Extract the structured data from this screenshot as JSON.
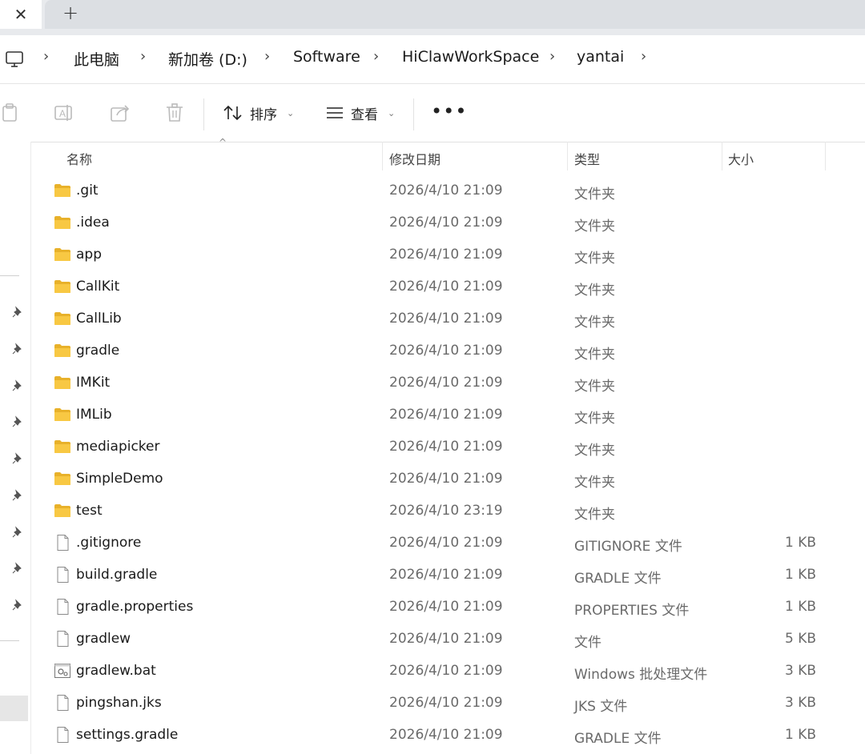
{
  "tabs": {
    "close_glyph": "✕",
    "new_glyph": "+"
  },
  "breadcrumb": [
    {
      "label": "此电脑"
    },
    {
      "label": "新加卷 (D:)"
    },
    {
      "label": "Software"
    },
    {
      "label": "HiClawWorkSpace"
    },
    {
      "label": "yantai"
    }
  ],
  "toolbar": {
    "sort_label": "排序",
    "view_label": "查看",
    "more_glyph": "•••"
  },
  "columns": {
    "name": "名称",
    "date": "修改日期",
    "type": "类型",
    "size": "大小"
  },
  "files": [
    {
      "name": ".git",
      "date": "2026/4/10 21:09",
      "type": "文件夹",
      "size": "",
      "icon": "folder-icon"
    },
    {
      "name": ".idea",
      "date": "2026/4/10 21:09",
      "type": "文件夹",
      "size": "",
      "icon": "folder-icon"
    },
    {
      "name": "app",
      "date": "2026/4/10 21:09",
      "type": "文件夹",
      "size": "",
      "icon": "folder-icon"
    },
    {
      "name": "CallKit",
      "date": "2026/4/10 21:09",
      "type": "文件夹",
      "size": "",
      "icon": "folder-icon"
    },
    {
      "name": "CallLib",
      "date": "2026/4/10 21:09",
      "type": "文件夹",
      "size": "",
      "icon": "folder-icon"
    },
    {
      "name": "gradle",
      "date": "2026/4/10 21:09",
      "type": "文件夹",
      "size": "",
      "icon": "folder-icon"
    },
    {
      "name": "IMKit",
      "date": "2026/4/10 21:09",
      "type": "文件夹",
      "size": "",
      "icon": "folder-icon"
    },
    {
      "name": "IMLib",
      "date": "2026/4/10 21:09",
      "type": "文件夹",
      "size": "",
      "icon": "folder-icon"
    },
    {
      "name": "mediapicker",
      "date": "2026/4/10 21:09",
      "type": "文件夹",
      "size": "",
      "icon": "folder-icon"
    },
    {
      "name": "SimpleDemo",
      "date": "2026/4/10 21:09",
      "type": "文件夹",
      "size": "",
      "icon": "folder-icon"
    },
    {
      "name": "test",
      "date": "2026/4/10 23:19",
      "type": "文件夹",
      "size": "",
      "icon": "folder-icon"
    },
    {
      "name": ".gitignore",
      "date": "2026/4/10 21:09",
      "type": "GITIGNORE 文件",
      "size": "1 KB",
      "icon": "file-icon"
    },
    {
      "name": "build.gradle",
      "date": "2026/4/10 21:09",
      "type": "GRADLE 文件",
      "size": "1 KB",
      "icon": "file-icon"
    },
    {
      "name": "gradle.properties",
      "date": "2026/4/10 21:09",
      "type": "PROPERTIES 文件",
      "size": "1 KB",
      "icon": "file-icon"
    },
    {
      "name": "gradlew",
      "date": "2026/4/10 21:09",
      "type": "文件",
      "size": "5 KB",
      "icon": "file-icon"
    },
    {
      "name": "gradlew.bat",
      "date": "2026/4/10 21:09",
      "type": "Windows 批处理文件",
      "size": "3 KB",
      "icon": "batch-file-icon"
    },
    {
      "name": "pingshan.jks",
      "date": "2026/4/10 21:09",
      "type": "JKS 文件",
      "size": "3 KB",
      "icon": "file-icon"
    },
    {
      "name": "settings.gradle",
      "date": "2026/4/10 21:09",
      "type": "GRADLE 文件",
      "size": "1 KB",
      "icon": "file-icon"
    }
  ],
  "colors": {
    "folder": "#f8c843",
    "folder_dark": "#e8b12a",
    "tab_bg": "#e8eaed",
    "toolbar_icon_disabled": "#b9b9b9"
  }
}
